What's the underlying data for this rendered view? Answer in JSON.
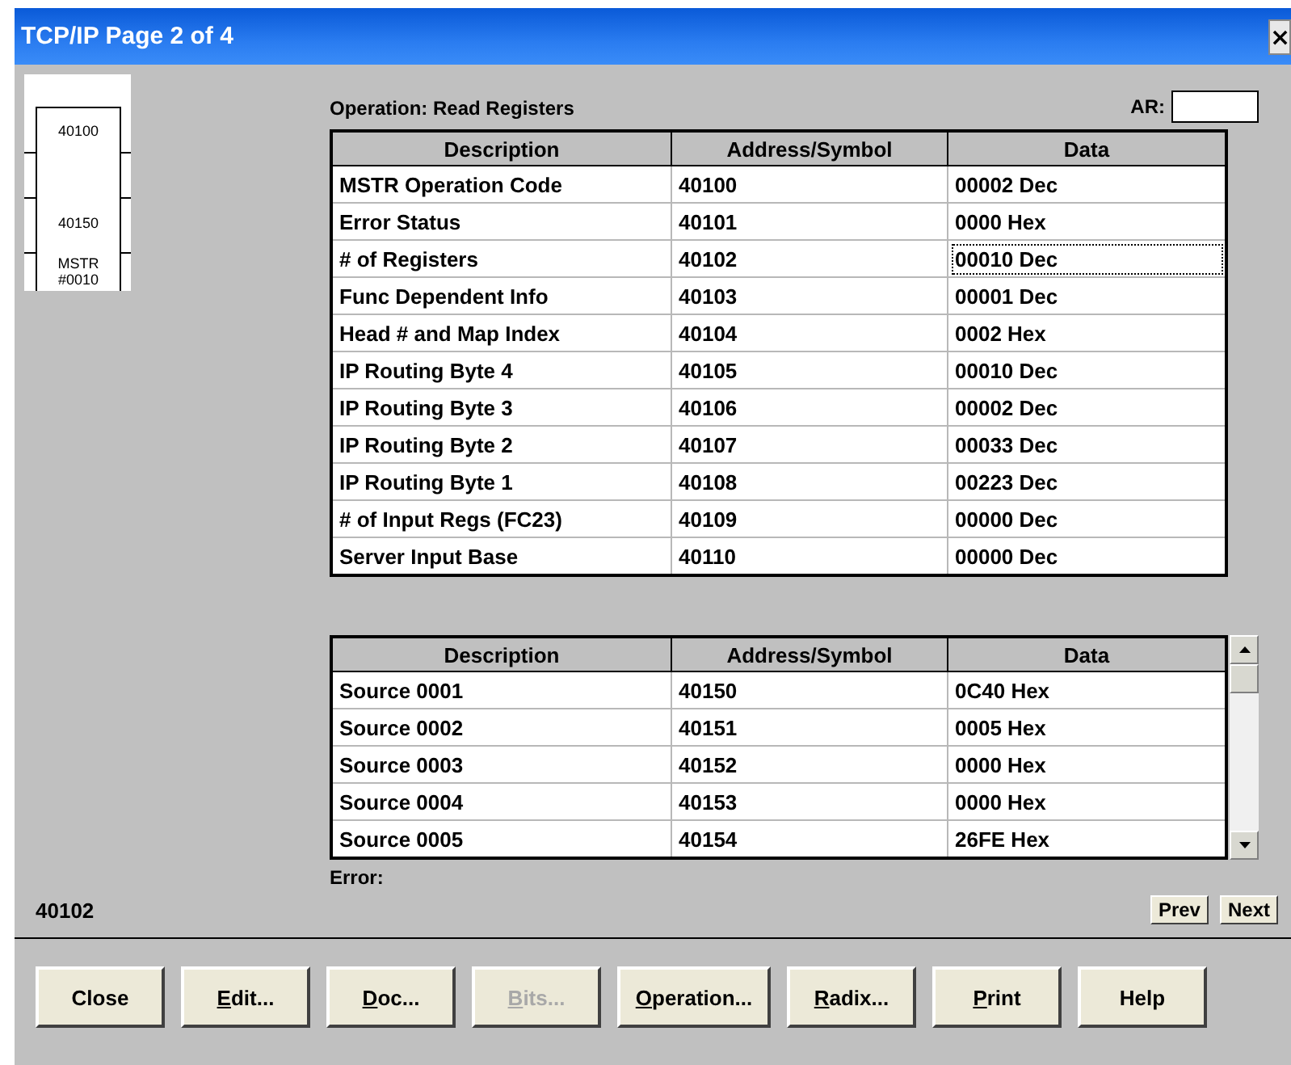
{
  "window": {
    "title": "TCP/IP Page 2 of 4",
    "close_glyph": "×"
  },
  "block": {
    "top_label": "40100",
    "middle_label": "40150",
    "bottom_label": "MSTR\n#0010"
  },
  "operation": "Operation: Read Registers",
  "ar": {
    "label": "AR:"
  },
  "table": {
    "columns": [
      "Description",
      "Address/Symbol",
      "Data"
    ],
    "rows": [
      {
        "description": "MSTR Operation Code",
        "address": "40100",
        "data": "00002 Dec",
        "focused": false
      },
      {
        "description": "Error Status",
        "address": "40101",
        "data": "0000 Hex",
        "focused": false
      },
      {
        "description": "# of Registers",
        "address": "40102",
        "data": "00010 Dec",
        "focused": true
      },
      {
        "description": "Func Dependent Info",
        "address": "40103",
        "data": "00001 Dec",
        "focused": false
      },
      {
        "description": "Head # and Map Index",
        "address": "40104",
        "data": "0002 Hex",
        "focused": false
      },
      {
        "description": "IP  Routing Byte 4",
        "address": "40105",
        "data": "00010 Dec",
        "focused": false
      },
      {
        "description": "IP  Routing Byte 3",
        "address": "40106",
        "data": "00002 Dec",
        "focused": false
      },
      {
        "description": "IP  Routing Byte 2",
        "address": "40107",
        "data": "00033 Dec",
        "focused": false
      },
      {
        "description": "IP  Routing Byte 1",
        "address": "40108",
        "data": "00223 Dec",
        "focused": false
      },
      {
        "description": "# of Input Regs (FC23)",
        "address": "40109",
        "data": "00000 Dec",
        "focused": false
      },
      {
        "description": "Server Input Base",
        "address": "40110",
        "data": "00000 Dec",
        "focused": false
      }
    ]
  },
  "source_table": {
    "columns": [
      "Description",
      "Address/Symbol",
      "Data"
    ],
    "rows": [
      {
        "description": "Source 0001",
        "address": "40150",
        "data": "0C40 Hex",
        "focused": false
      },
      {
        "description": "Source 0002",
        "address": "40151",
        "data": "0005 Hex",
        "focused": false
      },
      {
        "description": "Source 0003",
        "address": "40152",
        "data": "0000 Hex",
        "focused": false
      },
      {
        "description": "Source 0004",
        "address": "40153",
        "data": "0000 Hex",
        "focused": false
      },
      {
        "description": "Source 0005",
        "address": "40154",
        "data": "26FE Hex",
        "focused": false
      }
    ]
  },
  "error_label": "Error:",
  "current_address": "40102",
  "nav_buttons": [
    {
      "label": "Prev"
    },
    {
      "label": "Next"
    }
  ],
  "buttons": [
    {
      "label": "Close",
      "underlined_first": false,
      "disabled": false
    },
    {
      "label": "Edit...",
      "underlined_first": true,
      "disabled": false
    },
    {
      "label": "Doc...",
      "underlined_first": true,
      "disabled": false
    },
    {
      "label": "Bits...",
      "underlined_first": true,
      "disabled": true
    },
    {
      "label": "Operation...",
      "underlined_first": true,
      "disabled": false
    },
    {
      "label": "Radix...",
      "underlined_first": true,
      "disabled": false
    },
    {
      "label": "Print",
      "underlined_first": true,
      "disabled": false
    },
    {
      "label": "Help",
      "underlined_first": false,
      "disabled": false
    }
  ]
}
